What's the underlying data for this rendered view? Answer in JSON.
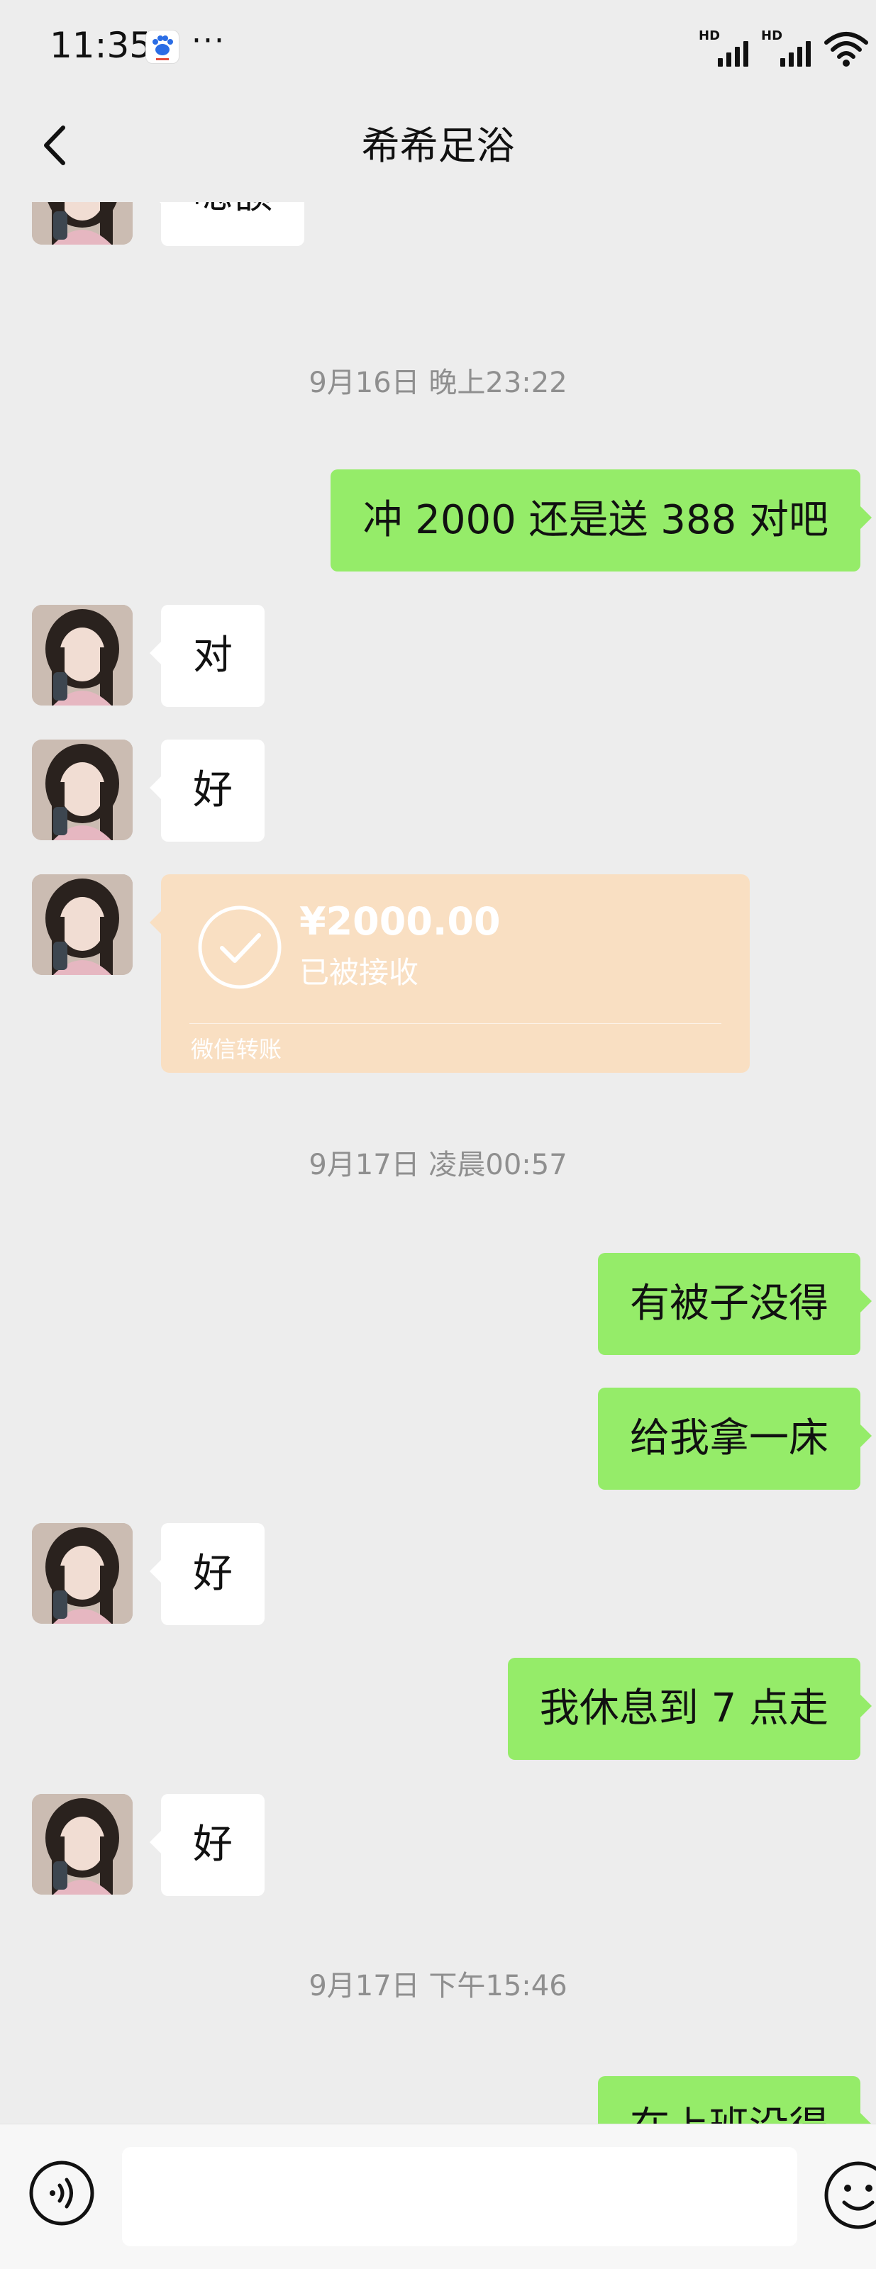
{
  "status_bar": {
    "time": "11:35",
    "more": "···",
    "signal_1_label": "HD",
    "signal_2_label": "HD"
  },
  "nav": {
    "title": "希希足浴"
  },
  "messages": {
    "m1": {
      "text": "嗯额"
    },
    "ts1": "9月16日 晚上23:22",
    "m2": {
      "text": "冲 2000 还是送 388 对吧"
    },
    "m3": {
      "text": "对"
    },
    "m4": {
      "text": "好"
    },
    "transfer": {
      "amount": "¥2000.00",
      "status": "已被接收",
      "footer": "微信转账"
    },
    "ts2": "9月17日 凌晨00:57",
    "m5": {
      "text": "有被子没得"
    },
    "m6": {
      "text": "给我拿一床"
    },
    "m7": {
      "text": "好"
    },
    "m8": {
      "text": "我休息到 7 点走"
    },
    "m9": {
      "text": "好"
    },
    "ts3": "9月17日 下午15:46",
    "m10": {
      "text": "在上班没得"
    }
  },
  "input_bar": {
    "value": ""
  },
  "colors": {
    "background": "#ededed",
    "sent_bubble": "#95ec69",
    "received_bubble": "#ffffff",
    "transfer_card": "#f9dfc2"
  }
}
